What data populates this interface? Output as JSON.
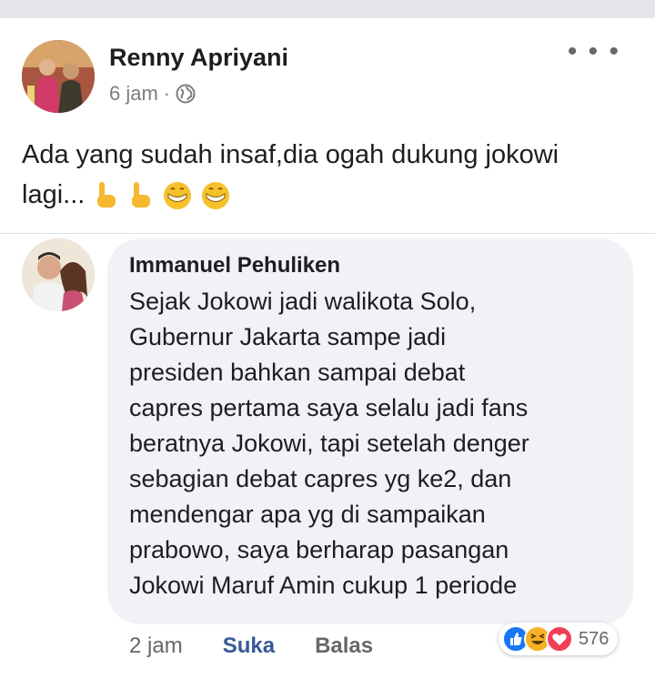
{
  "post": {
    "author": "Renny Apriyani",
    "time": "6 jam",
    "separator": "·",
    "text_line1": "Ada yang sudah insaf,dia ogah dukung jokowi",
    "text_line2": "lagi...",
    "emojis": [
      "pointing-down-icon",
      "pointing-down-icon",
      "grinning-face-icon",
      "grinning-face-icon"
    ]
  },
  "comment": {
    "author": "Immanuel Pehuliken",
    "lines": [
      "Sejak Jokowi jadi walikota Solo,",
      "Gubernur Jakarta sampe jadi",
      "presiden bahkan sampai debat",
      "capres pertama saya selalu jadi fans",
      "beratnya Jokowi, tapi setelah denger",
      "sebagian debat capres yg ke2, dan",
      "mendengar apa yg di sampaikan",
      "prabowo, saya berharap pasangan",
      "Jokowi Maruf Amin cukup 1 periode"
    ],
    "time": "2 jam",
    "like_label": "Suka",
    "reply_label": "Balas",
    "reaction_count": "576",
    "reactions": [
      "like-icon",
      "haha-icon",
      "love-icon"
    ]
  },
  "colors": {
    "link_blue": "#385898",
    "meta_gray": "#65676b",
    "bubble_bg": "#f0f2f5",
    "like_blue": "#1877f2",
    "love_red": "#f33e58",
    "haha_yellow": "#f7b125"
  }
}
